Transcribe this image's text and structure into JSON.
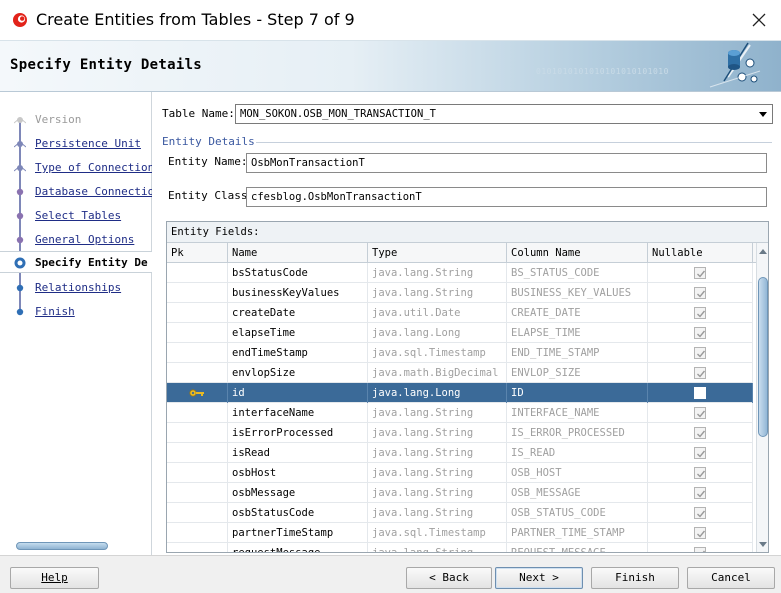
{
  "window": {
    "title": "Create Entities from Tables - Step 7 of 9"
  },
  "header": {
    "title": "Specify Entity Details",
    "bits": "0101010101010101010101010"
  },
  "nav": {
    "items": [
      {
        "label": "Version",
        "state": "disabled"
      },
      {
        "label": "Persistence Unit",
        "state": "visited"
      },
      {
        "label": "Type of Connection",
        "state": "visited"
      },
      {
        "label": "Database Connection",
        "state": "visited"
      },
      {
        "label": "Select Tables",
        "state": "visited"
      },
      {
        "label": "General Options",
        "state": "visited"
      },
      {
        "label": "Specify Entity De",
        "state": "current"
      },
      {
        "label": "Relationships",
        "state": "todo"
      },
      {
        "label": "Finish",
        "state": "todo"
      }
    ]
  },
  "form": {
    "table_name_label": "Table Name:",
    "table_name_value": "MON_SOKON.OSB_MON_TRANSACTION_T",
    "section_title": "Entity Details",
    "entity_name_label": "Entity Name:",
    "entity_name_value": "OsbMonTransactionT",
    "entity_class_label": "Entity Class:",
    "entity_class_value": "cfesblog.OsbMonTransactionT"
  },
  "grid": {
    "caption": "Entity Fields:",
    "columns": [
      "Pk",
      "Name",
      "Type",
      "Column Name",
      "Nullable"
    ],
    "rows": [
      {
        "pk": false,
        "name": "bsStatusCode",
        "type": "java.lang.String",
        "column": "BS_STATUS_CODE",
        "nullable": true
      },
      {
        "pk": false,
        "name": "businessKeyValues",
        "type": "java.lang.String",
        "column": "BUSINESS_KEY_VALUES",
        "nullable": true
      },
      {
        "pk": false,
        "name": "createDate",
        "type": "java.util.Date",
        "column": "CREATE_DATE",
        "nullable": true
      },
      {
        "pk": false,
        "name": "elapseTime",
        "type": "java.lang.Long",
        "column": "ELAPSE_TIME",
        "nullable": true
      },
      {
        "pk": false,
        "name": "endTimeStamp",
        "type": "java.sql.Timestamp",
        "column": "END_TIME_STAMP",
        "nullable": true
      },
      {
        "pk": false,
        "name": "envlopSize",
        "type": "java.math.BigDecimal",
        "column": "ENVLOP_SIZE",
        "nullable": true
      },
      {
        "pk": true,
        "name": "id",
        "type": "java.lang.Long",
        "column": "ID",
        "nullable": false,
        "selected": true
      },
      {
        "pk": false,
        "name": "interfaceName",
        "type": "java.lang.String",
        "column": "INTERFACE_NAME",
        "nullable": true
      },
      {
        "pk": false,
        "name": "isErrorProcessed",
        "type": "java.lang.String",
        "column": "IS_ERROR_PROCESSED",
        "nullable": true
      },
      {
        "pk": false,
        "name": "isRead",
        "type": "java.lang.String",
        "column": "IS_READ",
        "nullable": true
      },
      {
        "pk": false,
        "name": "osbHost",
        "type": "java.lang.String",
        "column": "OSB_HOST",
        "nullable": true
      },
      {
        "pk": false,
        "name": "osbMessage",
        "type": "java.lang.String",
        "column": "OSB_MESSAGE",
        "nullable": true
      },
      {
        "pk": false,
        "name": "osbStatusCode",
        "type": "java.lang.String",
        "column": "OSB_STATUS_CODE",
        "nullable": true
      },
      {
        "pk": false,
        "name": "partnerTimeStamp",
        "type": "java.sql.Timestamp",
        "column": "PARTNER_TIME_STAMP",
        "nullable": true
      },
      {
        "pk": false,
        "name": "requestMessage",
        "type": "java.lang.String",
        "column": "REQUEST_MESSAGE",
        "nullable": true
      }
    ]
  },
  "buttons": {
    "help": "Help",
    "back": "< Back",
    "next": "Next >",
    "finish": "Finish",
    "cancel": "Cancel"
  },
  "colors": {
    "selected_row": "#3b6a98",
    "link": "#1f2d86",
    "nav_line": "#7e87b8"
  }
}
